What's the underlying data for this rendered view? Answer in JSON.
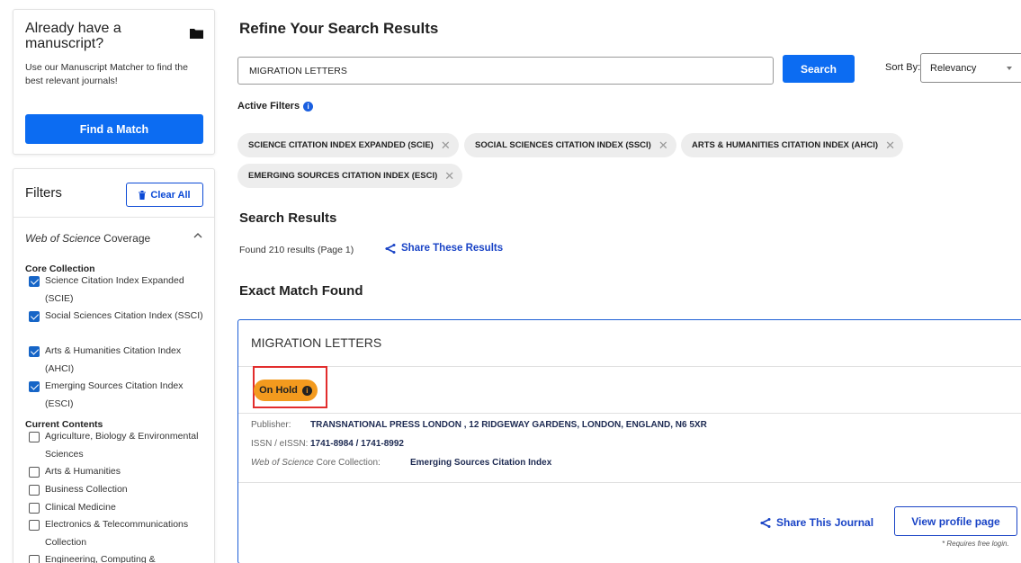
{
  "matcher": {
    "title": "Already have a manuscript?",
    "description": "Use our Manuscript Matcher to find the best relevant journals!",
    "button": "Find a Match",
    "icon": "folder-icon"
  },
  "filters": {
    "title": "Filters",
    "clear_all": "Clear All",
    "coverage_em": "Web of Science",
    "coverage_rest": " Coverage",
    "core_heading": "Core Collection",
    "core_items": [
      {
        "label": "Science Citation Index Expanded (SCIE)",
        "checked": true
      },
      {
        "label": "Social Sciences Citation Index (SSCI)",
        "checked": true
      },
      {
        "label": "Arts & Humanities Citation Index (AHCI)",
        "checked": true
      },
      {
        "label": "Emerging Sources Citation Index (ESCI)",
        "checked": true
      }
    ],
    "contents_heading": "Current Contents",
    "contents_items": [
      {
        "label": "Agriculture, Biology & Environmental Sciences",
        "checked": false
      },
      {
        "label": "Arts & Humanities",
        "checked": false
      },
      {
        "label": "Business Collection",
        "checked": false
      },
      {
        "label": "Clinical Medicine",
        "checked": false
      },
      {
        "label": "Electronics & Telecommunications Collection",
        "checked": false
      },
      {
        "label": "Engineering, Computing &",
        "checked": false
      }
    ]
  },
  "main": {
    "title": "Refine Your Search Results",
    "search_value": "MIGRATION LETTERS",
    "search_button": "Search",
    "sort_label": "Sort By:",
    "sort_value": "Relevancy",
    "active_filters_label": "Active Filters",
    "chips": [
      "SCIENCE CITATION INDEX EXPANDED (SCIE)",
      "SOCIAL SCIENCES CITATION INDEX (SSCI)",
      "ARTS & HUMANITIES CITATION INDEX (AHCI)",
      "EMERGING SOURCES CITATION INDEX (ESCI)"
    ],
    "results_title": "Search Results",
    "found_text": "Found 210 results (Page 1)",
    "share_results": "Share These Results",
    "exact_match": "Exact Match Found"
  },
  "journal": {
    "title": "MIGRATION LETTERS",
    "status": "On Hold",
    "publisher_label": "Publisher:",
    "publisher_value": "TRANSNATIONAL PRESS LONDON , 12 RIDGEWAY GARDENS, LONDON, ENGLAND, N6 5XR",
    "issn_label": "ISSN / eISSN:",
    "issn_value": "1741-8984 / 1741-8992",
    "coverage_label_em": "Web of Science",
    "coverage_label_rest": " Core Collection:",
    "coverage_value": "Emerging Sources Citation Index",
    "share": "Share This Journal",
    "profile_button": "View profile page",
    "requires_note": "* Requires free login."
  },
  "colors": {
    "primary_button": "#0c6cf2",
    "link": "#1a44c6",
    "on_hold": "#f39a1e",
    "highlight_frame": "#e22d2d"
  }
}
